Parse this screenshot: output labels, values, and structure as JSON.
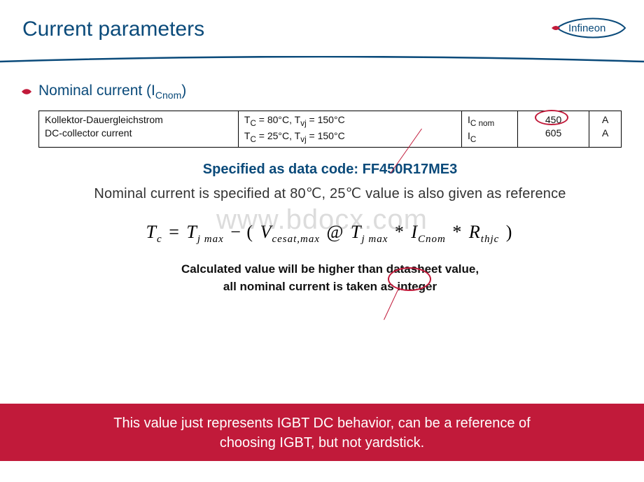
{
  "header": {
    "title": "Current parameters",
    "logo_name": "Infineon"
  },
  "subheading": {
    "prefix": "Nominal current (I",
    "subscript": "Cnom",
    "suffix": ")"
  },
  "table": {
    "col1_line1": "Kollektor-Dauergleichstrom",
    "col1_line2": "DC-collector current",
    "col2_line1": "T_C = 80°C, T_vj = 150°C",
    "col2_line2": "T_C = 25°C, T_vj = 150°C",
    "col3_line1": "I_C nom",
    "col3_line2": "I_C",
    "col4_line1": "450",
    "col4_line2": "605",
    "col5_line1": "A",
    "col5_line2": "A"
  },
  "code_line": "Specified as data code: FF450R17ME3",
  "note1": "Nominal current is specified at 80℃, 25℃ value is also given as reference",
  "formula": {
    "seg1": "T",
    "sub_c": "c",
    "eq": " = ",
    "seg2": "T",
    "sub_jmax1": "j max",
    "minus": " − (",
    "seg3": "V",
    "sub_cesat": "cesat,max",
    "at": " @",
    "seg4": "T",
    "sub_jmax2": "j max",
    "star1": " *",
    "seg5": "I",
    "sub_cnom": "Cnom",
    "star2": "*",
    "seg6": " R",
    "sub_thjc": "thjc",
    "close": " )"
  },
  "note2_line1": "Calculated value will be higher than datasheet value,",
  "note2_line2": "all nominal current is taken as integer",
  "footer_line1": "This value just represents IGBT DC behavior, can be a reference of",
  "footer_line2": "choosing IGBT, but not yardstick.",
  "watermark": "www.bdocx.com"
}
